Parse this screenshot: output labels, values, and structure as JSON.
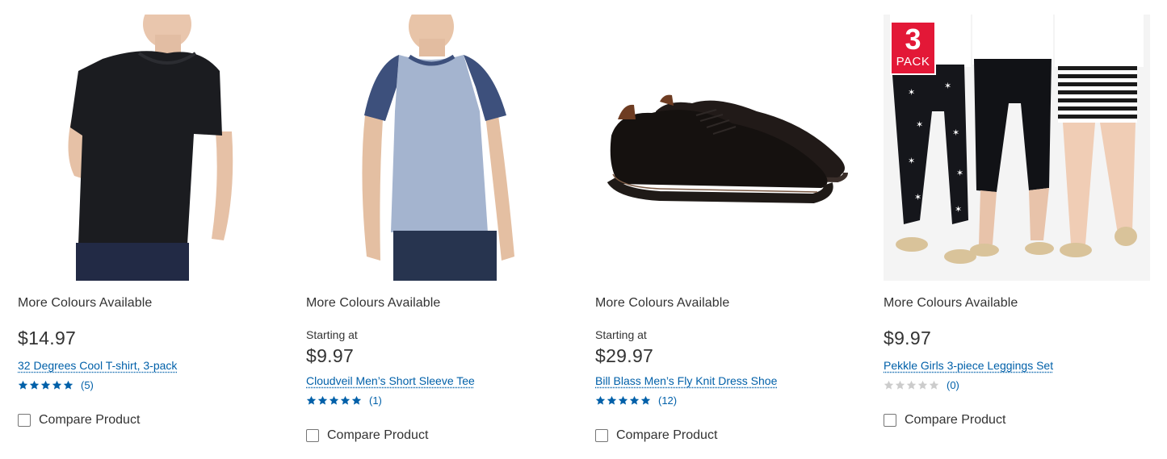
{
  "products": [
    {
      "availability": "More Colours Available",
      "starting_label": "",
      "price": "$14.97",
      "title": "32 Degrees Cool T-shirt, 3-pack",
      "rating_stars": 5,
      "review_count": "(5)",
      "compare_label": "Compare Product"
    },
    {
      "availability": "More Colours Available",
      "starting_label": "Starting at",
      "price": "$9.97",
      "title": "Cloudveil Men’s Short Sleeve Tee",
      "rating_stars": 5,
      "review_count": "(1)",
      "compare_label": "Compare Product"
    },
    {
      "availability": "More Colours Available",
      "starting_label": "Starting at",
      "price": "$29.97",
      "title": "Bill Blass Men’s Fly Knit Dress Shoe",
      "rating_stars": 5,
      "review_count": "(12)",
      "compare_label": "Compare Product"
    },
    {
      "availability": "More Colours Available",
      "starting_label": "",
      "price": "$9.97",
      "title": "Pekkle Girls 3-piece Leggings Set",
      "rating_stars": 0,
      "review_count": "(0)",
      "compare_label": "Compare Product",
      "badge": {
        "number": "3",
        "text": "PACK"
      }
    }
  ],
  "colors": {
    "link": "#0060a9",
    "star_filled": "#0060a9",
    "star_empty": "#cccccc",
    "badge_red": "#e31837"
  }
}
